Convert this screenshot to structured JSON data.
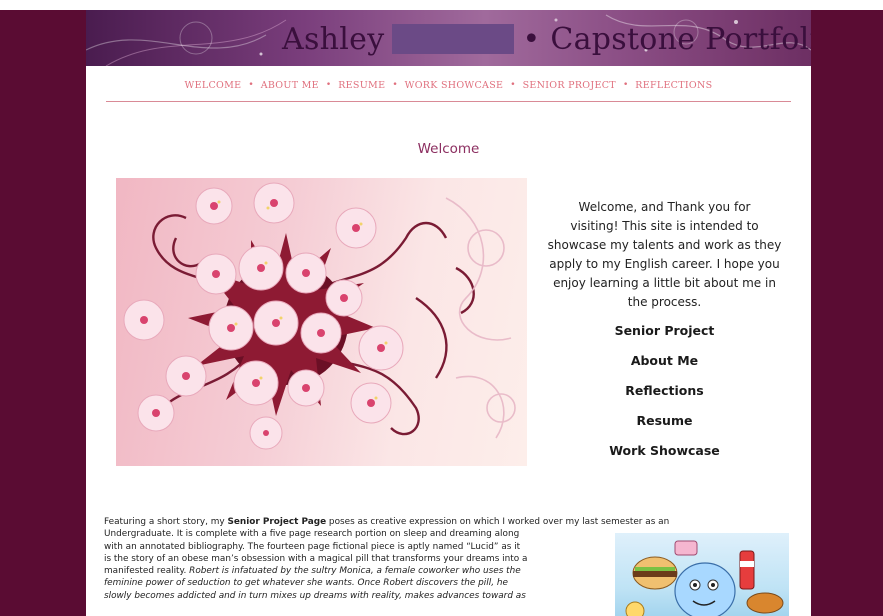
{
  "banner": {
    "name_first": "Ashley",
    "name_rest": "• Capstone Portfolio"
  },
  "nav": {
    "items": [
      {
        "label": "WELCOME"
      },
      {
        "label": "ABOUT ME"
      },
      {
        "label": "RESUME"
      },
      {
        "label": "WORK SHOWCASE"
      },
      {
        "label": "SENIOR PROJECT"
      },
      {
        "label": "REFLECTIONS"
      }
    ],
    "separator": "•"
  },
  "welcome": {
    "heading": "Welcome",
    "intro_lines": [
      "Welcome, and Thank you for",
      "visiting! This site is intended to",
      "showcase my talents and work as they",
      "apply to my English career.  I hope you",
      "enjoy learning a little bit about me in",
      "the process."
    ],
    "links": [
      {
        "label": "Senior Project"
      },
      {
        "label": "About Me"
      },
      {
        "label": "Reflections"
      },
      {
        "label": "Resume"
      },
      {
        "label": "Work Showcase"
      }
    ]
  },
  "article": {
    "l1_a": "Featuring a short story, my ",
    "l1_b": "Senior Project Page",
    "l1_c": " poses as creative expression on which I worked over my last semester as an",
    "l2": "Undergraduate.  It is complete with a five page research portion on sleep and dreaming along",
    "l3": "with an annotated bibliography. The fourteen page fictional piece is aptly named “Lucid” as it",
    "l4": "is the story of an obese man’s obsession with a magical pill that transforms your dreams into a",
    "l5_a": "manifested reality.  ",
    "l5_b": "Robert is infatuated by the sultry Monica, a female coworker who uses the",
    "l6": "feminine power of seduction to get whatever she wants. Once Robert discovers the pill, he",
    "l7": "slowly becomes addicted and in turn mixes up dreams with reality, makes advances toward as"
  },
  "colors": {
    "background": "#5a0c33",
    "nav": "#e0707e",
    "heading": "#8b2d5f",
    "rule": "#d98a96"
  }
}
